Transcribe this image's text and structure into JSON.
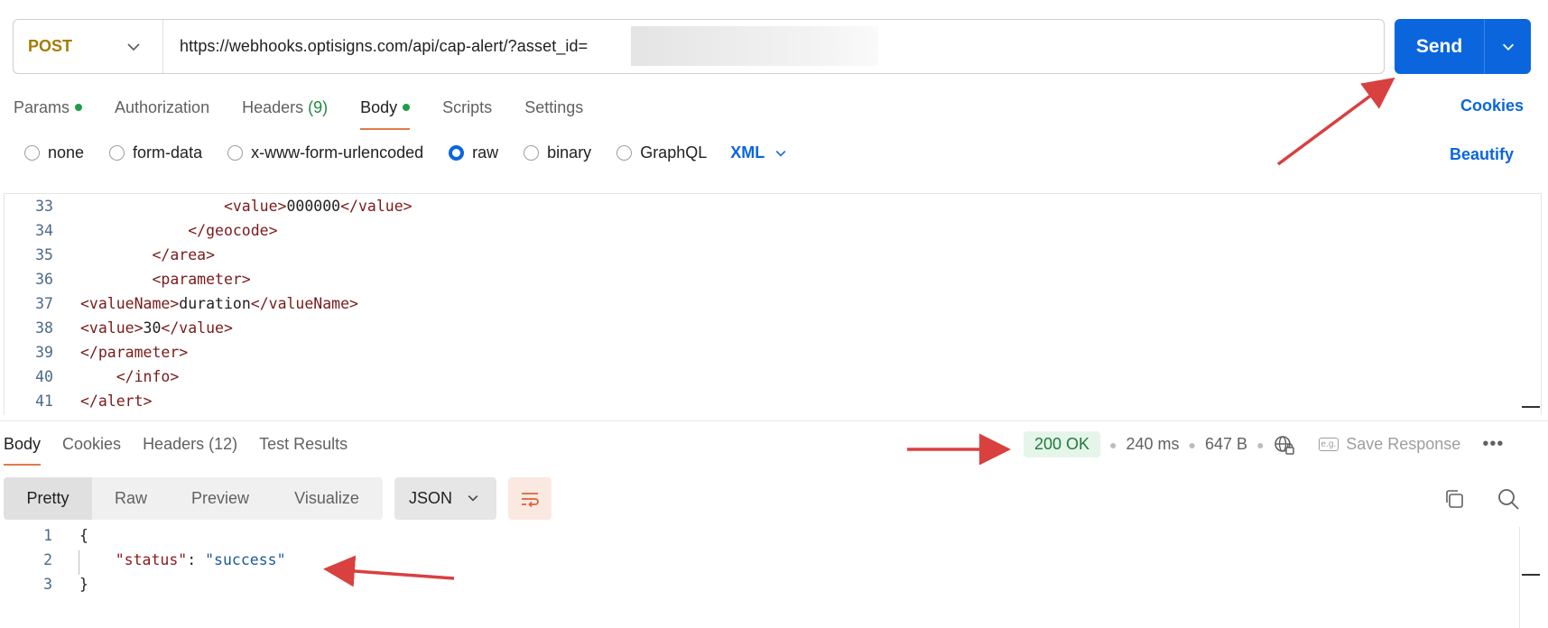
{
  "request": {
    "method": "POST",
    "url": "https://webhooks.optisigns.com/api/cap-alert/?asset_id=",
    "send_label": "Send"
  },
  "request_tabs": {
    "params": "Params",
    "authorization": "Authorization",
    "headers": "Headers",
    "headers_count": "(9)",
    "body": "Body",
    "scripts": "Scripts",
    "settings": "Settings",
    "cookies": "Cookies"
  },
  "body_types": {
    "none": "none",
    "form_data": "form-data",
    "urlencoded": "x-www-form-urlencoded",
    "raw": "raw",
    "binary": "binary",
    "graphql": "GraphQL",
    "language": "XML",
    "beautify": "Beautify"
  },
  "editor_lines": [
    {
      "n": "33",
      "code": "                <value>000000</value>"
    },
    {
      "n": "34",
      "code": "            </geocode>"
    },
    {
      "n": "35",
      "code": "        </area>"
    },
    {
      "n": "36",
      "code": "        <parameter>"
    },
    {
      "n": "37",
      "code": "<valueName>duration</valueName>"
    },
    {
      "n": "38",
      "code": "<value>30</value>"
    },
    {
      "n": "39",
      "code": "</parameter>"
    },
    {
      "n": "40",
      "code": "    </info>"
    },
    {
      "n": "41",
      "code": "</alert>"
    }
  ],
  "response_tabs": {
    "body": "Body",
    "cookies": "Cookies",
    "headers": "Headers",
    "headers_count": "(12)",
    "test_results": "Test Results"
  },
  "response_status": {
    "code": "200 OK",
    "time": "240 ms",
    "size": "647 B",
    "save": "Save Response",
    "save_badge": "e.g."
  },
  "response_view": {
    "pretty": "Pretty",
    "raw": "Raw",
    "preview": "Preview",
    "visualize": "Visualize",
    "format": "JSON"
  },
  "response_lines": {
    "l1": {
      "n": "1",
      "text": "{"
    },
    "l2": {
      "n": "2",
      "key": "\"status\"",
      "colon": ": ",
      "value": "\"success\""
    },
    "l3": {
      "n": "3",
      "text": "}"
    }
  },
  "colors": {
    "accent": "#0b66dd",
    "method": "#a67c00",
    "ok": "#1e7a3c",
    "tab_underline": "#e07a4a",
    "annotation": "#d94040"
  },
  "icons": [
    "chevron-down-icon",
    "globe-lock-icon",
    "more-icon",
    "wrap-lines-icon",
    "copy-icon",
    "search-icon"
  ]
}
